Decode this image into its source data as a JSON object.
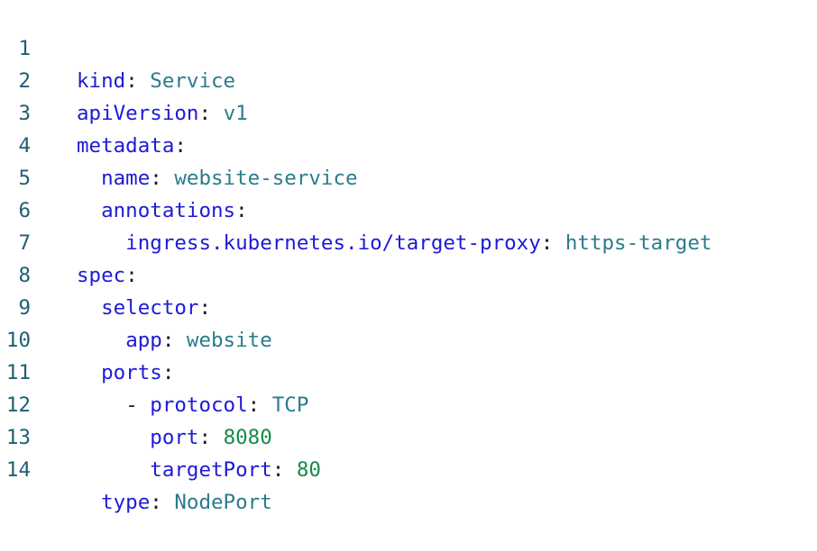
{
  "lines": [
    {
      "number": "1",
      "indent": "",
      "dash": "",
      "key": "kind",
      "value": "Service",
      "value_type": "string"
    },
    {
      "number": "2",
      "indent": "",
      "dash": "",
      "key": "apiVersion",
      "value": "v1",
      "value_type": "string"
    },
    {
      "number": "3",
      "indent": "",
      "dash": "",
      "key": "metadata",
      "value": "",
      "value_type": "none"
    },
    {
      "number": "4",
      "indent": "  ",
      "dash": "",
      "key": "name",
      "value": "website-service",
      "value_type": "string"
    },
    {
      "number": "5",
      "indent": "  ",
      "dash": "",
      "key": "annotations",
      "value": "",
      "value_type": "none"
    },
    {
      "number": "6",
      "indent": "    ",
      "dash": "",
      "key": "ingress.kubernetes.io/target-proxy",
      "value": "https-target",
      "value_type": "string"
    },
    {
      "number": "7",
      "indent": "",
      "dash": "",
      "key": "spec",
      "value": "",
      "value_type": "none"
    },
    {
      "number": "8",
      "indent": "  ",
      "dash": "",
      "key": "selector",
      "value": "",
      "value_type": "none"
    },
    {
      "number": "9",
      "indent": "    ",
      "dash": "",
      "key": "app",
      "value": "website",
      "value_type": "string"
    },
    {
      "number": "10",
      "indent": "  ",
      "dash": "",
      "key": "ports",
      "value": "",
      "value_type": "none"
    },
    {
      "number": "11",
      "indent": "    ",
      "dash": "- ",
      "key": "protocol",
      "value": "TCP",
      "value_type": "string"
    },
    {
      "number": "12",
      "indent": "      ",
      "dash": "",
      "key": "port",
      "value": "8080",
      "value_type": "number"
    },
    {
      "number": "13",
      "indent": "      ",
      "dash": "",
      "key": "targetPort",
      "value": "80",
      "value_type": "number"
    },
    {
      "number": "14",
      "indent": "  ",
      "dash": "",
      "key": "type",
      "value": "NodePort",
      "value_type": "string"
    }
  ],
  "syntax_colors": {
    "line_number": "#1f5f73",
    "key": "#1d1bd6",
    "string": "#2b7b8c",
    "number": "#178a4a",
    "punctuation": "#1b1b1b"
  }
}
